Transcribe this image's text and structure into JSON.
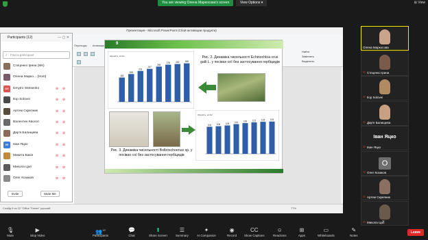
{
  "topbar": {
    "viewing_text": "You are viewing Олена Маркосова's screen",
    "view_options": "View Options",
    "view_label": "View"
  },
  "ppt": {
    "title": "Презентация - Microsoft PowerPoint (Сбой активации продукта)",
    "tabs": [
      "Переходы",
      "Анимация",
      "Показ слайдов",
      "Рецензирование",
      "Вид"
    ],
    "ribbon_right": [
      "Найти",
      "Заменить",
      "Выделить"
    ],
    "slide": {
      "number": "9",
      "caption1": "Рис. 2. Динаміка чисельності Echinochloa crus galli L. у посівах сої без застосування гербіцидів",
      "caption2": "Рис. 3. Динаміка чисельності Bolboschoenus sp. у посівах сої без застосування гербіцидів",
      "chart1_ylabel": "Кількість, шт/м²",
      "chart2_ylabel": "Кількість, шт/м²"
    },
    "status": "Слайд 9 из 22   \"Office Theme\"   русский",
    "zoom": "77%"
  },
  "chart_data": [
    {
      "type": "bar",
      "title": "",
      "ylabel": "Кількість, шт/м²",
      "values": [
        182,
        208,
        231,
        247,
        264,
        278,
        283,
        288
      ]
    },
    {
      "type": "bar",
      "title": "",
      "ylabel": "Кількість, шт/м²",
      "values": [
        104,
        106,
        109,
        114,
        118,
        121,
        123,
        124
      ]
    }
  ],
  "participants": {
    "header": "Participants (12)",
    "search_placeholder": "Find a participant",
    "items": [
      {
        "name": "Стеценко Ірина (Me)",
        "initials": "",
        "color": "#8a6d5a",
        "mic": "",
        "cam": ""
      },
      {
        "name": "Олена Марко... (Host)",
        "initials": "",
        "color": "#7a5a6a",
        "mic": "",
        "cam": ""
      },
      {
        "name": "Dmytro Stetsenko",
        "initials": "DS",
        "color": "#d9534f",
        "mic": "⊘",
        "cam": "⊘"
      },
      {
        "name": "Ilор Solovei",
        "initials": "",
        "color": "#4a4a4a",
        "mic": "⊘",
        "cam": "⊘"
      },
      {
        "name": "Артем Скрепник",
        "initials": "",
        "color": "#5a4a3a",
        "mic": "⊘",
        "cam": "⊘"
      },
      {
        "name": "Валентин Кволот",
        "initials": "",
        "color": "#6a6a6a",
        "mic": "⊘",
        "cam": "⊘"
      },
      {
        "name": "Дар'я Балищева",
        "initials": "",
        "color": "#8a6a5a",
        "mic": "⊘",
        "cam": "⊘"
      },
      {
        "name": "Іван Яцко",
        "initials": "ІЯ",
        "color": "#3b7dd8",
        "mic": "⊘",
        "cam": "⊘"
      },
      {
        "name": "Микита Бакін",
        "initials": "",
        "color": "#c08a3a",
        "mic": "⊘",
        "cam": "⊘"
      },
      {
        "name": "Микола Цап",
        "initials": "",
        "color": "#5a5a5a",
        "mic": "⊘",
        "cam": "⊘"
      },
      {
        "name": "Олег Козаков",
        "initials": "",
        "color": "#8a8a8a",
        "mic": "⊘",
        "cam": "⊘"
      }
    ],
    "invite": "Invite",
    "mute_me": "Mute Me"
  },
  "gallery": {
    "tiles": [
      {
        "label": "Олена Маркосова",
        "face": "#c9a48a"
      },
      {
        "label": "Стеценко Ірина",
        "face": "#7a5a4a"
      },
      {
        "label": "Ilор Solovei",
        "face": "#b08a60"
      },
      {
        "label": "Дар'я Балищева",
        "face": "#c8a080"
      },
      {
        "label": "Іван Яцко",
        "bigname": "Іван Яцко"
      },
      {
        "label": "Олег Козаков",
        "initial": "O"
      },
      {
        "label": "Артем Скрепник",
        "face": "#8a7060"
      },
      {
        "label": "Микола Цап",
        "face": "#6a5a4a"
      }
    ]
  },
  "toolbar": {
    "mute": "Mute",
    "stop_video": "Stop Video",
    "participants": "Participants",
    "participants_count": "12",
    "chat": "Chat",
    "share_screen": "Share Screen",
    "summary": "Summary",
    "ai_companion": "AI Companion",
    "record": "Record",
    "show_captions": "Show Captions",
    "reactions": "Reactions",
    "apps": "Apps",
    "whiteboards": "Whiteboards",
    "notes": "Notes",
    "leave": "Leave"
  }
}
